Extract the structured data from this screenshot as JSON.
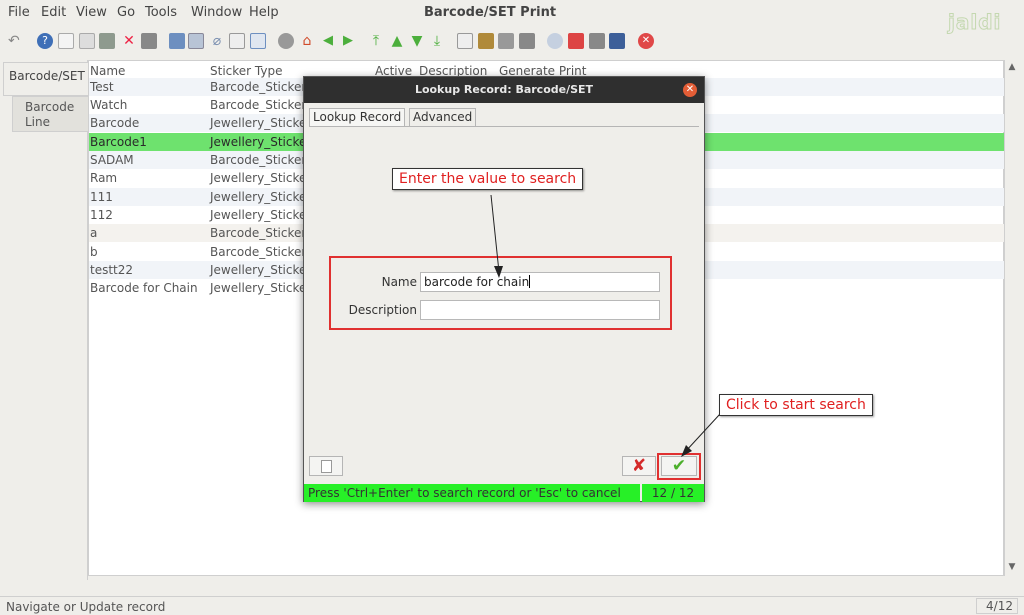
{
  "menu": [
    {
      "label": "File"
    },
    {
      "label": "Edit"
    },
    {
      "label": "View"
    },
    {
      "label": "Go"
    },
    {
      "label": "Tools"
    },
    {
      "label": "Window"
    },
    {
      "label": "Help"
    }
  ],
  "app_title": "Barcode/SET Print",
  "logo_text": "jaldi",
  "left_tabs": {
    "main": "Barcode/SET",
    "sub_line1": "Barcode",
    "sub_line2": "Line"
  },
  "grid": {
    "columns": [
      "Name",
      "Sticker Type",
      "Active",
      "Description",
      "Generate Print"
    ],
    "rows": [
      {
        "name": "Test",
        "sticker": "Barcode_Sticker"
      },
      {
        "name": "Watch",
        "sticker": "Barcode_Sticker"
      },
      {
        "name": "Barcode",
        "sticker": "Jewellery_Sticker"
      },
      {
        "name": "Barcode1",
        "sticker": "Jewellery_Sticker"
      },
      {
        "name": "SADAM",
        "sticker": "Barcode_Sticker"
      },
      {
        "name": "Ram",
        "sticker": "Jewellery_Sticker"
      },
      {
        "name": "111",
        "sticker": "Jewellery_Sticker"
      },
      {
        "name": "112",
        "sticker": "Jewellery_Sticker"
      },
      {
        "name": "a",
        "sticker": "Barcode_Sticker"
      },
      {
        "name": "b",
        "sticker": "Barcode_Sticker"
      },
      {
        "name": "testt22",
        "sticker": "Jewellery_Sticker"
      },
      {
        "name": "Barcode for Chain",
        "sticker": "Jewellery_Sticker"
      }
    ]
  },
  "status": {
    "text": "Navigate or Update record",
    "count": "4/12"
  },
  "dialog": {
    "title": "Lookup Record: Barcode/SET",
    "tabs": [
      "Lookup Record",
      "Advanced"
    ],
    "name_label": "Name",
    "name_value": "barcode for chain",
    "description_label": "Description",
    "description_value": "",
    "status": "Press 'Ctrl+Enter' to search record or 'Esc' to cancel",
    "count": "12 / 12"
  },
  "callouts": {
    "enter_value": "Enter the value to search",
    "start_search": "Click to start search"
  },
  "colors": {
    "selected_row": "#6ee26e",
    "status_green": "#27f027",
    "callout_red": "#e02020"
  }
}
